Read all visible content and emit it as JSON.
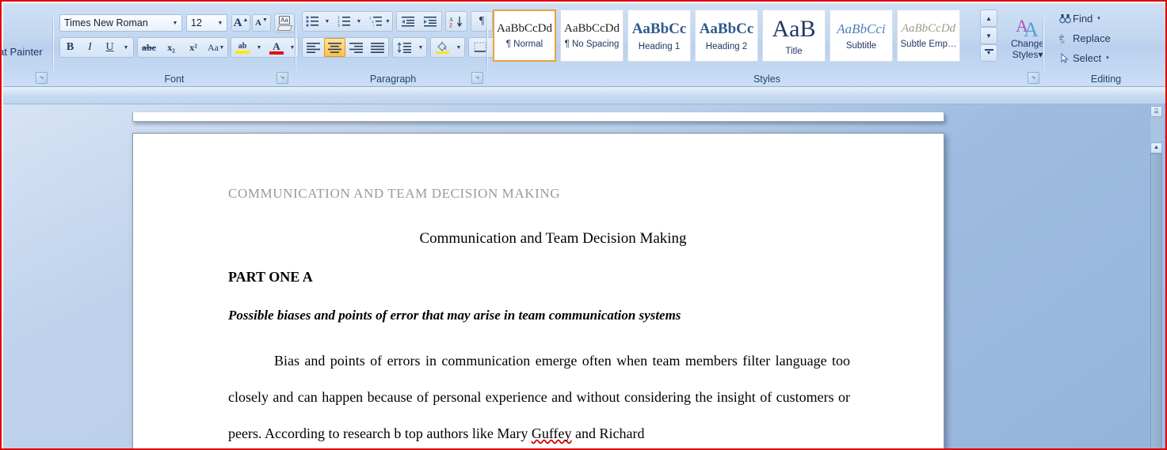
{
  "ribbon": {
    "clipboard": {
      "format_painter_label": "at Painter",
      "launcher_glyph": "⤷"
    },
    "font": {
      "group_label": "Font",
      "font_name": "Times New Roman",
      "font_size": "12",
      "grow_font": "A",
      "shrink_font": "A",
      "clear_formatting": "Aa",
      "bold": "B",
      "italic": "I",
      "underline": "U",
      "strikethrough": "abc",
      "subscript": "x₂",
      "superscript": "x²",
      "change_case": "Aa",
      "highlight": "ab",
      "highlight_color": "#ffe800",
      "font_color": "A",
      "font_color_swatch": "#e01010",
      "launcher_glyph": "⤷"
    },
    "paragraph": {
      "group_label": "Paragraph",
      "bullets": "bullets-icon",
      "numbering": "numbering-icon",
      "multilevel": "multilevel-list-icon",
      "decrease_indent": "decrease-indent-icon",
      "increase_indent": "increase-indent-icon",
      "sort": "A\nZ",
      "show_marks": "¶",
      "align_left": "align-left-icon",
      "align_center": "align-center-icon",
      "align_right": "align-right-icon",
      "justify": "justify-icon",
      "line_spacing": "line-spacing-icon",
      "shading": "shading-icon",
      "borders": "borders-icon",
      "active_alignment": "align_center",
      "active_color": "#ffc04d",
      "launcher_glyph": "⤷"
    },
    "styles": {
      "group_label": "Styles",
      "gallery": [
        {
          "preview": "AaBbCcDd",
          "name": "¶ Normal",
          "preview_size": "15px",
          "preview_weight": "normal",
          "preview_style": "normal",
          "preview_color": "#1d1d1d",
          "active": true
        },
        {
          "preview": "AaBbCcDd",
          "name": "¶ No Spacing",
          "preview_size": "15px",
          "preview_weight": "normal",
          "preview_style": "normal",
          "preview_color": "#1d1d1d",
          "active": false
        },
        {
          "preview": "AaBbCс",
          "name": "Heading 1",
          "preview_size": "19px",
          "preview_weight": "bold",
          "preview_style": "normal",
          "preview_color": "#2e5a8e",
          "active": false
        },
        {
          "preview": "AaBbCc",
          "name": "Heading 2",
          "preview_size": "19px",
          "preview_weight": "bold",
          "preview_style": "normal",
          "preview_color": "#2e5a8e",
          "active": false
        },
        {
          "preview": "AaB",
          "name": "Title",
          "preview_size": "30px",
          "preview_weight": "normal",
          "preview_style": "normal",
          "preview_color": "#1f3864",
          "active": false
        },
        {
          "preview": "AaBbCcі",
          "name": "Subtitle",
          "preview_size": "17px",
          "preview_weight": "normal",
          "preview_style": "italic",
          "preview_color": "#4a7ebb",
          "active": false
        },
        {
          "preview": "AaBbCcDd",
          "name": "Subtle Emp…",
          "preview_size": "15px",
          "preview_weight": "normal",
          "preview_style": "italic",
          "preview_color": "#9b9b8a",
          "active": false
        }
      ],
      "scroll_up": "▲",
      "scroll_down": "▼",
      "more": "▼",
      "change_styles_label_1": "Change",
      "change_styles_label_2": "Styles",
      "change_styles_caret": "▾",
      "launcher_glyph": "⤷"
    },
    "editing": {
      "group_label": "Editing",
      "items": [
        {
          "label": "Find",
          "icon": "binoculars-icon",
          "caret": "▾"
        },
        {
          "label": "Replace",
          "icon": "replace-icon",
          "caret": ""
        },
        {
          "label": "Select",
          "icon": "cursor-icon",
          "caret": "▾"
        }
      ]
    }
  },
  "document": {
    "header": "COMMUNICATION  AND  TEAM DECISION  MAKING",
    "title": "Communication and Team Decision Making",
    "part_heading": "PART ONE A",
    "sub_heading": "Possible biases and points of error that may arise in team communication systems",
    "paragraph_part_1": "Bias and points of errors in communication emerge often when team members filter language too closely and can happen because of personal experience and without considering the insight of customers or peers. According to research b top authors like Mary ",
    "paragraph_misspelled": "Guffey",
    "paragraph_part_2": " and Richard"
  },
  "scrollbar": {
    "split_glyph": "⌸",
    "up_glyph": "▲"
  }
}
